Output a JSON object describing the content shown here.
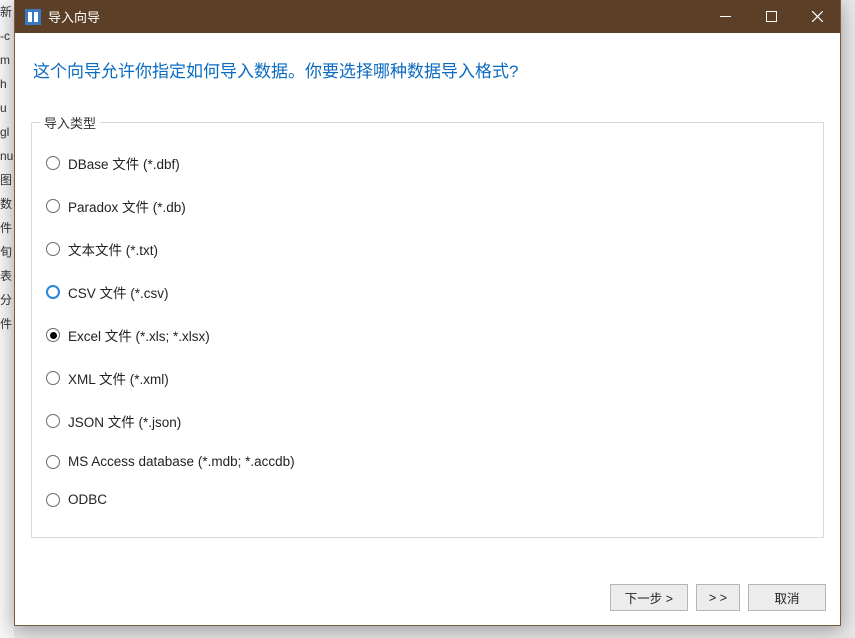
{
  "bg_fragments": [
    "新",
    "-c",
    "",
    "m",
    "h",
    "u",
    "gl",
    "nu",
    "",
    "图",
    "数",
    "件",
    "旬",
    "表",
    "分",
    "件"
  ],
  "window": {
    "title": "导入向导"
  },
  "heading": "这个向导允许你指定如何导入数据。你要选择哪种数据导入格式?",
  "fieldset": {
    "legend": "导入类型",
    "options": [
      {
        "label": "DBase 文件 (*.dbf)",
        "checked": false,
        "focused": false
      },
      {
        "label": "Paradox 文件 (*.db)",
        "checked": false,
        "focused": false
      },
      {
        "label": "文本文件 (*.txt)",
        "checked": false,
        "focused": false
      },
      {
        "label": "CSV 文件 (*.csv)",
        "checked": false,
        "focused": true
      },
      {
        "label": "Excel 文件 (*.xls; *.xlsx)",
        "checked": true,
        "focused": false
      },
      {
        "label": "XML 文件 (*.xml)",
        "checked": false,
        "focused": false
      },
      {
        "label": "JSON 文件 (*.json)",
        "checked": false,
        "focused": false
      },
      {
        "label": "MS Access database (*.mdb; *.accdb)",
        "checked": false,
        "focused": false
      },
      {
        "label": "ODBC",
        "checked": false,
        "focused": false
      }
    ]
  },
  "footer": {
    "next": "下一步 >",
    "skip": "> >",
    "cancel": "取消"
  }
}
